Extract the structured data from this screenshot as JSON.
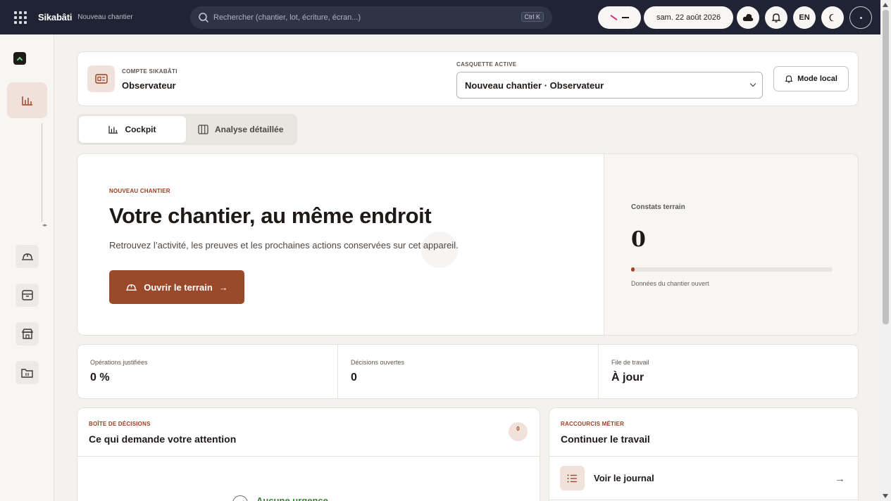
{
  "app": {
    "name": "Sikabâti",
    "context": "Nouveau chantier"
  },
  "search": {
    "placeholder": "Rechercher (chantier, lot, écriture, écran...)",
    "shortcut": "Ctrl K"
  },
  "header_controls": {
    "date": "sam. 22 août 2026",
    "language": "EN",
    "icons": [
      "sync-status-icon",
      "cloud-icon",
      "bell-icon",
      "moon-icon",
      "profile-icon"
    ]
  },
  "account": {
    "kicker": "COMPTE SIKABÂTI",
    "name": "Observateur",
    "hat_kicker": "CASQUETTE ACTIVE",
    "hat_value": "Nouveau chantier · Observateur",
    "mode_button": "Mode local"
  },
  "tabs": [
    {
      "label": "Cockpit",
      "active": true
    },
    {
      "label": "Analyse détaillée",
      "active": false
    }
  ],
  "hero": {
    "kicker": "NOUVEAU CHANTIER",
    "title": "Votre chantier, au même endroit",
    "description": "Retrouvez l’activité, les preuves et les prochaines actions conservées sur cet appareil.",
    "cta": "Ouvrir le terrain",
    "stat_label": "Constats terrain",
    "stat_value": "0",
    "stat_progress": 0,
    "stat_caption": "Données du chantier ouvert"
  },
  "kpis": [
    {
      "label": "Opérations justifiées",
      "value": "0 %"
    },
    {
      "label": "Décisions ouvertes",
      "value": "0"
    },
    {
      "label": "File de travail",
      "value": "À jour"
    }
  ],
  "decisions": {
    "kicker": "BOÎTE DE DÉCISIONS",
    "title": "Ce qui demande votre attention",
    "count": "0",
    "empty_text": "Aucune urgence"
  },
  "shortcuts": {
    "kicker": "RACCOURCIS MÉTIER",
    "title": "Continuer le travail",
    "items": [
      {
        "label": "Voir le journal"
      }
    ]
  },
  "colors": {
    "topbar": "#1f2333",
    "accent": "#9a4a2b",
    "accent_soft": "#f1e1db",
    "success": "#3f7e3a"
  }
}
